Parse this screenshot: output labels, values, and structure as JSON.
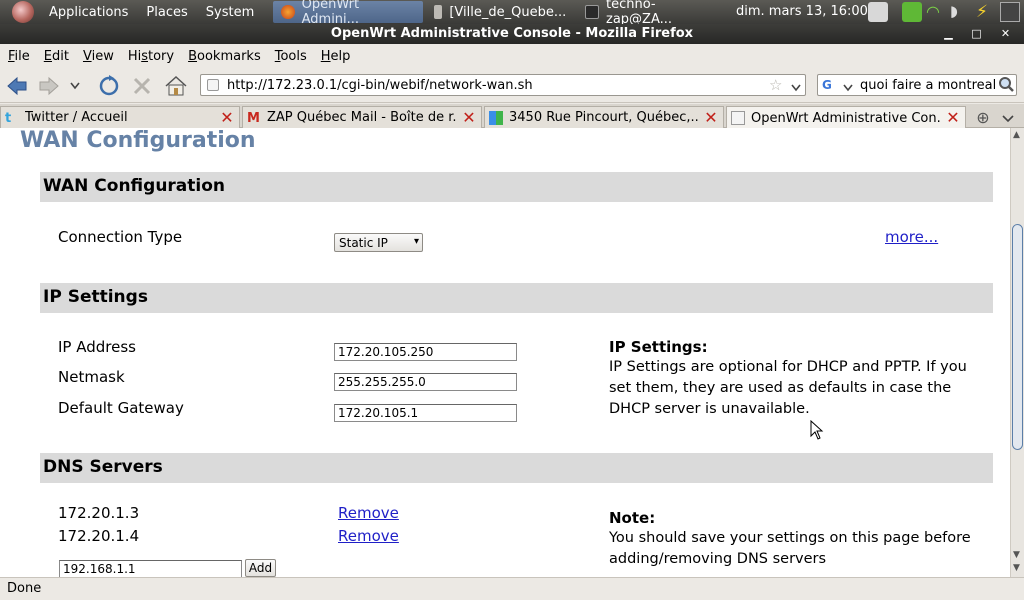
{
  "panel": {
    "menus": [
      "Applications",
      "Places",
      "System"
    ],
    "tasks": [
      {
        "label": "OpenWrt Admini...",
        "active": true,
        "icon": "firefox-icon"
      },
      {
        "label": "[Ville_de_Queb e...",
        "active": false,
        "icon": "document-icon"
      },
      {
        "label": "techno-zap@ZA...",
        "active": false,
        "icon": "terminal-icon"
      }
    ],
    "clock": "dim. mars 13, 16:00"
  },
  "window": {
    "title": "OpenWrt Administrative Console - Mozilla Firefox"
  },
  "menubar": {
    "items": [
      {
        "pre": "",
        "key": "F",
        "post": "ile"
      },
      {
        "pre": "",
        "key": "E",
        "post": "dit"
      },
      {
        "pre": "",
        "key": "V",
        "post": "iew"
      },
      {
        "pre": "Hi",
        "key": "s",
        "post": "tory"
      },
      {
        "pre": "",
        "key": "B",
        "post": "ookmarks"
      },
      {
        "pre": "",
        "key": "T",
        "post": "ools"
      },
      {
        "pre": "",
        "key": "H",
        "post": "elp"
      }
    ]
  },
  "navbar": {
    "url": "http://172.23.0.1/cgi-bin/webif/network-wan.sh",
    "search": "quoi faire a montreal"
  },
  "tabs": [
    {
      "label": "Twitter / Accueil",
      "selected": false
    },
    {
      "label": "ZAP Québec Mail - Boîte de r...",
      "selected": false
    },
    {
      "label": "3450 Rue Pincourt, Québec,...",
      "selected": false
    },
    {
      "label": "OpenWrt Administrative Con...",
      "selected": true
    }
  ],
  "page": {
    "title": "WAN Configuration",
    "wan": {
      "heading": "WAN Configuration",
      "connection_type_label": "Connection Type",
      "connection_type_value": "Static IP",
      "more_link": "more..."
    },
    "ip": {
      "heading": "IP Settings",
      "ip_label": "IP Address",
      "ip_value": "172.20.105.250",
      "netmask_label": "Netmask",
      "netmask_value": "255.255.255.0",
      "gateway_label": "Default Gateway",
      "gateway_value": "172.20.105.1",
      "help_title": "IP Settings:",
      "help_text": "IP Settings are optional for DHCP and PPTP. If you set them, they are used as defaults in case the DHCP server is unavailable."
    },
    "dns": {
      "heading": "DNS Servers",
      "servers": [
        "172.20.1.3",
        "172.20.1.4"
      ],
      "remove_label": "Remove",
      "new_server_value": "192.168.1.1",
      "add_label": "Add",
      "note_title": "Note:",
      "note_text": "You should save your settings on this page before adding/removing DNS servers"
    }
  },
  "status": "Done"
}
